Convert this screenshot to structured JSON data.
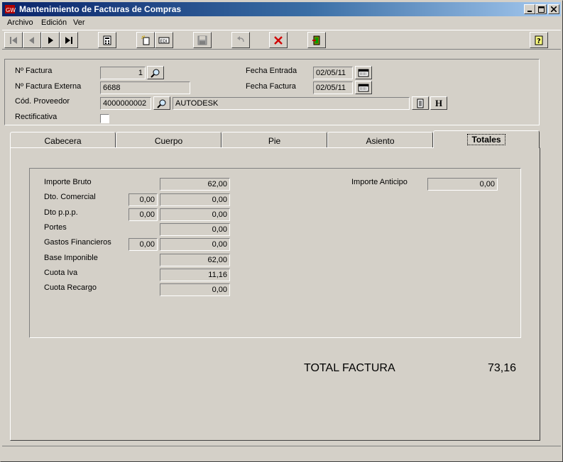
{
  "window": {
    "title": "Mantenimiento de Facturas de Compras"
  },
  "menu": [
    "Archivo",
    "Edición",
    "Ver"
  ],
  "toolbar": {
    "icons": [
      "first-record-icon",
      "previous-record-icon",
      "next-record-icon",
      "last-record-icon",
      "calculator-icon",
      "new-document-icon",
      "edit-icon",
      "save-icon",
      "undo-icon",
      "delete-icon",
      "exit-icon",
      "help-icon"
    ]
  },
  "header": {
    "nro_factura_label": "Nº Factura",
    "nro_factura_value": "1",
    "nro_factura_externa_label": "Nº Factura Externa",
    "nro_factura_externa_value": "6688",
    "cod_proveedor_label": "Cód. Proveedor",
    "cod_proveedor_value": "4000000002",
    "proveedor_nombre": "AUTODESK",
    "rectificativa_label": "Rectificativa",
    "rectificativa_checked": false,
    "fecha_entrada_label": "Fecha Entrada",
    "fecha_entrada_value": "02/05/11",
    "fecha_factura_label": "Fecha Factura",
    "fecha_factura_value": "02/05/11",
    "h_button_label": "H"
  },
  "tabs": [
    {
      "label": "Cabecera",
      "active": false
    },
    {
      "label": "Cuerpo",
      "active": false
    },
    {
      "label": "Pie",
      "active": false
    },
    {
      "label": "Asiento",
      "active": false
    },
    {
      "label": "Totales",
      "active": true
    }
  ],
  "totales": {
    "importe_bruto_label": "Importe Bruto",
    "importe_bruto_value": "62,00",
    "dto_comercial_label": "Dto. Comercial",
    "dto_comercial_pct": "0,00",
    "dto_comercial_value": "0,00",
    "dto_ppp_label": "Dto p.p.p.",
    "dto_ppp_pct": "0,00",
    "dto_ppp_value": "0,00",
    "portes_label": "Portes",
    "portes_value": "0,00",
    "gastos_financieros_label": "Gastos Financieros",
    "gastos_financieros_pct": "0,00",
    "gastos_financieros_value": "0,00",
    "base_imponible_label": "Base Imponible",
    "base_imponible_value": "62,00",
    "cuota_iva_label": "Cuota Iva",
    "cuota_iva_value": "11,16",
    "cuota_recargo_label": "Cuota Recargo",
    "cuota_recargo_value": "0,00",
    "importe_anticipo_label": "Importe Anticipo",
    "importe_anticipo_value": "0,00"
  },
  "total_factura": {
    "label": "TOTAL FACTURA",
    "value": "73,16"
  }
}
